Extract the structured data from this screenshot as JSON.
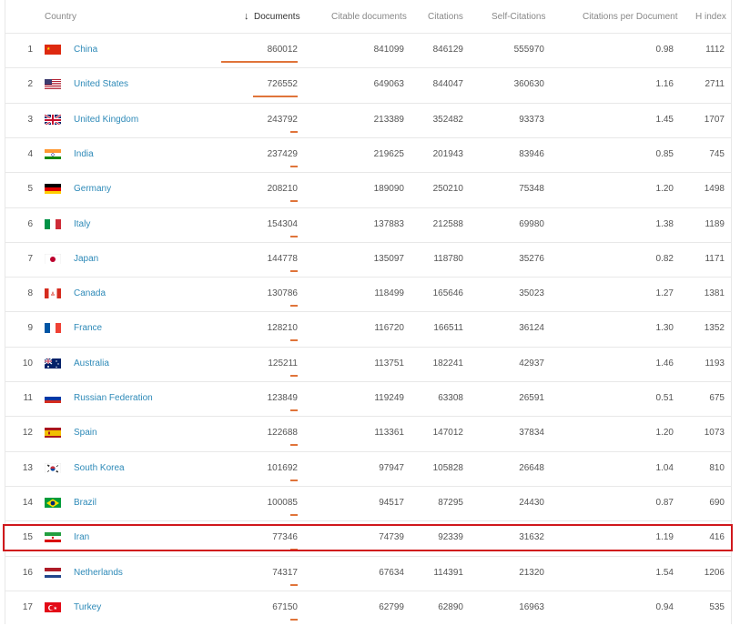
{
  "table": {
    "headers": {
      "country": "Country",
      "documents": "Documents",
      "citable": "Citable documents",
      "citations": "Citations",
      "self_citations": "Self-Citations",
      "cpd": "Citations per Document",
      "hindex": "H index"
    },
    "sort_arrow_icon": "arrow-down-icon",
    "accent_color": "#e0743a",
    "highlight_color": "#d0181c",
    "rows": [
      {
        "rank": "1",
        "country": "China",
        "flag": "china",
        "documents": "860012",
        "citable": "841099",
        "citations": "846129",
        "self": "555970",
        "cpd": "0.98",
        "h": "1112"
      },
      {
        "rank": "2",
        "country": "United States",
        "flag": "usa",
        "documents": "726552",
        "citable": "649063",
        "citations": "844047",
        "self": "360630",
        "cpd": "1.16",
        "h": "2711"
      },
      {
        "rank": "3",
        "country": "United Kingdom",
        "flag": "uk",
        "documents": "243792",
        "citable": "213389",
        "citations": "352482",
        "self": "93373",
        "cpd": "1.45",
        "h": "1707"
      },
      {
        "rank": "4",
        "country": "India",
        "flag": "india",
        "documents": "237429",
        "citable": "219625",
        "citations": "201943",
        "self": "83946",
        "cpd": "0.85",
        "h": "745"
      },
      {
        "rank": "5",
        "country": "Germany",
        "flag": "germany",
        "documents": "208210",
        "citable": "189090",
        "citations": "250210",
        "self": "75348",
        "cpd": "1.20",
        "h": "1498"
      },
      {
        "rank": "6",
        "country": "Italy",
        "flag": "italy",
        "documents": "154304",
        "citable": "137883",
        "citations": "212588",
        "self": "69980",
        "cpd": "1.38",
        "h": "1189"
      },
      {
        "rank": "7",
        "country": "Japan",
        "flag": "japan",
        "documents": "144778",
        "citable": "135097",
        "citations": "118780",
        "self": "35276",
        "cpd": "0.82",
        "h": "1171"
      },
      {
        "rank": "8",
        "country": "Canada",
        "flag": "canada",
        "documents": "130786",
        "citable": "118499",
        "citations": "165646",
        "self": "35023",
        "cpd": "1.27",
        "h": "1381"
      },
      {
        "rank": "9",
        "country": "France",
        "flag": "france",
        "documents": "128210",
        "citable": "116720",
        "citations": "166511",
        "self": "36124",
        "cpd": "1.30",
        "h": "1352"
      },
      {
        "rank": "10",
        "country": "Australia",
        "flag": "australia",
        "documents": "125211",
        "citable": "113751",
        "citations": "182241",
        "self": "42937",
        "cpd": "1.46",
        "h": "1193"
      },
      {
        "rank": "11",
        "country": "Russian Federation",
        "flag": "russia",
        "documents": "123849",
        "citable": "119249",
        "citations": "63308",
        "self": "26591",
        "cpd": "0.51",
        "h": "675"
      },
      {
        "rank": "12",
        "country": "Spain",
        "flag": "spain",
        "documents": "122688",
        "citable": "113361",
        "citations": "147012",
        "self": "37834",
        "cpd": "1.20",
        "h": "1073"
      },
      {
        "rank": "13",
        "country": "South Korea",
        "flag": "korea",
        "documents": "101692",
        "citable": "97947",
        "citations": "105828",
        "self": "26648",
        "cpd": "1.04",
        "h": "810"
      },
      {
        "rank": "14",
        "country": "Brazil",
        "flag": "brazil",
        "documents": "100085",
        "citable": "94517",
        "citations": "87295",
        "self": "24430",
        "cpd": "0.87",
        "h": "690"
      },
      {
        "rank": "15",
        "country": "Iran",
        "flag": "iran",
        "documents": "77346",
        "citable": "74739",
        "citations": "92339",
        "self": "31632",
        "cpd": "1.19",
        "h": "416"
      },
      {
        "rank": "16",
        "country": "Netherlands",
        "flag": "netherlands",
        "documents": "74317",
        "citable": "67634",
        "citations": "114391",
        "self": "21320",
        "cpd": "1.54",
        "h": "1206"
      },
      {
        "rank": "17",
        "country": "Turkey",
        "flag": "turkey",
        "documents": "67150",
        "citable": "62799",
        "citations": "62890",
        "self": "16963",
        "cpd": "0.94",
        "h": "535"
      }
    ]
  }
}
